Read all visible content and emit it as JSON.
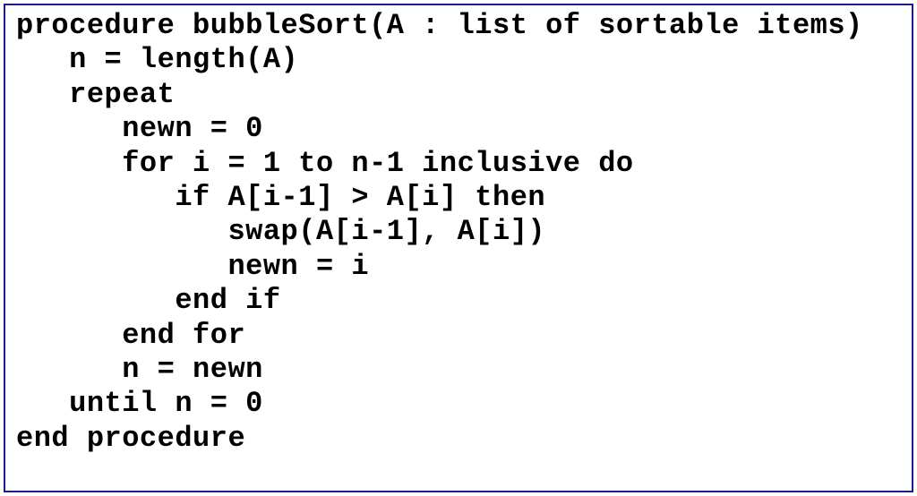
{
  "code": {
    "lines": [
      "procedure bubbleSort(A : list of sortable items)",
      "   n = length(A)",
      "   repeat",
      "      newn = 0",
      "      for i = 1 to n-1 inclusive do",
      "         if A[i-1] > A[i] then",
      "            swap(A[i-1], A[i])",
      "            newn = i",
      "         end if",
      "      end for",
      "      n = newn",
      "   until n = 0",
      "end procedure"
    ]
  },
  "colors": {
    "border": "#1a1a8f",
    "text": "#000000",
    "background": "#ffffff"
  }
}
